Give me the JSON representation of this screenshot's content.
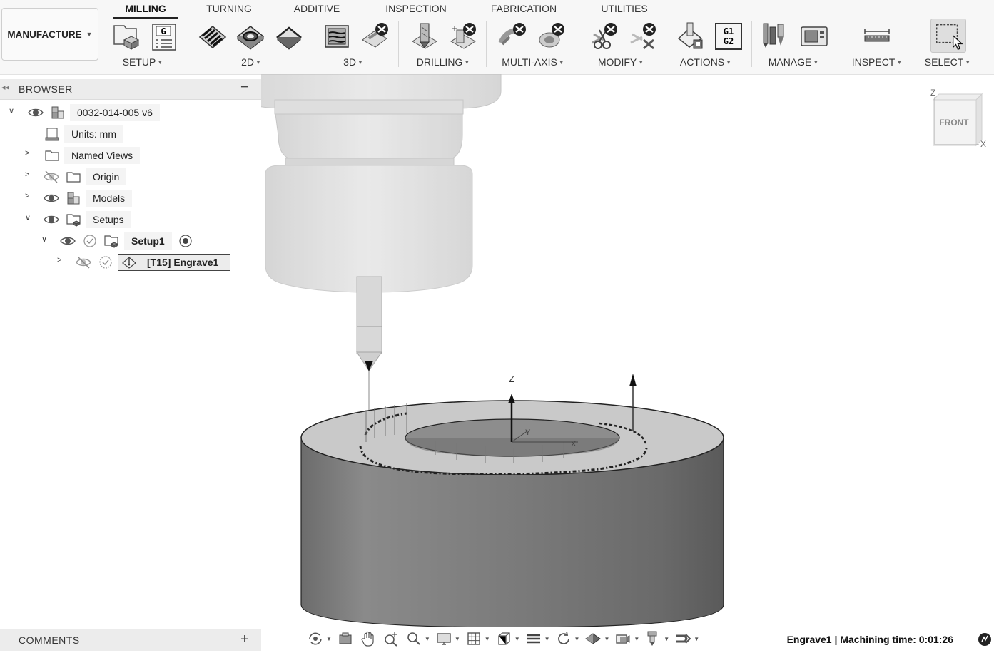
{
  "workspace": {
    "label": "MANUFACTURE"
  },
  "tabs": [
    {
      "label": "MILLING",
      "active": true
    },
    {
      "label": "TURNING"
    },
    {
      "label": "ADDITIVE"
    },
    {
      "label": "INSPECTION"
    },
    {
      "label": "FABRICATION"
    },
    {
      "label": "UTILITIES"
    }
  ],
  "panels": {
    "setup": "SETUP",
    "twod": "2D",
    "threed": "3D",
    "drilling": "DRILLING",
    "multiaxis": "MULTI-AXIS",
    "modify": "MODIFY",
    "actions": "ACTIONS",
    "manage": "MANAGE",
    "inspect": "INSPECT",
    "select": "SELECT"
  },
  "icons": {
    "g_code_label": "G",
    "g1g2_top": "G1",
    "g1g2_bottom": "G2"
  },
  "browser": {
    "title": "BROWSER",
    "items": [
      {
        "label": "0032-014-005 v6"
      },
      {
        "label": "Units: mm"
      },
      {
        "label": "Named Views"
      },
      {
        "label": "Origin"
      },
      {
        "label": "Models"
      },
      {
        "label": "Setups"
      },
      {
        "label": "Setup1"
      },
      {
        "label": "[T15] Engrave1"
      }
    ]
  },
  "viewport": {
    "axis_z": "Z",
    "axis_y": "Y",
    "axis_x": "X",
    "viewcube": {
      "face": "FRONT",
      "axis_z": "Z",
      "axis_x": "X"
    }
  },
  "comments": {
    "title": "COMMENTS"
  },
  "status": {
    "text": "Engrave1 | Machining time: 0:01:26"
  },
  "colors": {
    "stock_side": "#7a7a7a",
    "stock_top": "#bdbdbd",
    "holder": "#d6d6d6",
    "accent": "#222222"
  }
}
